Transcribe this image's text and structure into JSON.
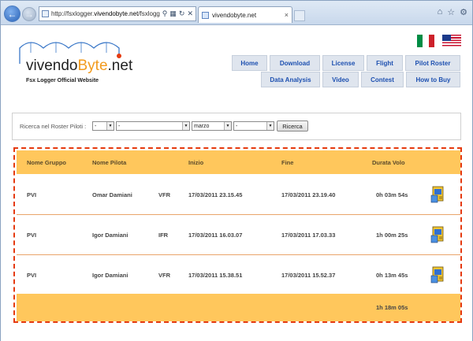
{
  "browser": {
    "address_prefix": "http://fsxlogger.",
    "address_domain": "vivendobyte.net",
    "address_suffix": "/fsxlogger/",
    "tab_title": "vivendobyte.net"
  },
  "site": {
    "logo_main": "vivendo",
    "logo_accent": "Byte",
    "logo_tail": ".net",
    "logo_subtitle": "Fsx Logger Official Website",
    "menu_row1": [
      "Home",
      "Download",
      "License",
      "Flight",
      "Pilot Roster"
    ],
    "menu_row2": [
      "Data Analysis",
      "Video",
      "Contest",
      "How to Buy"
    ],
    "colors": {
      "accent": "#f29b1d",
      "menu_text": "#1d50b0",
      "table_header": "#ffc75c",
      "frame": "#e53a10"
    }
  },
  "search": {
    "label": "Ricerca nel Roster Piloti :",
    "select1": "-",
    "select2": "-",
    "select3": "marzo",
    "select4": "-",
    "button": "Ricerca"
  },
  "table": {
    "headers": [
      "Nome Gruppo",
      "Nome Pilota",
      "",
      "Inizio",
      "Fine",
      "Durata Volo"
    ],
    "rows": [
      {
        "group": "PVI",
        "pilot": "Omar Damiani",
        "rule": "VFR",
        "start": "17/03/2011 23.15.45",
        "end": "17/03/2011 23.19.40",
        "duration": "0h 03m 54s",
        "icon": "flight-log-icon"
      },
      {
        "group": "PVI",
        "pilot": "Igor Damiani",
        "rule": "IFR",
        "start": "17/03/2011 16.03.07",
        "end": "17/03/2011 17.03.33",
        "duration": "1h 00m 25s",
        "icon": "flight-log-icon"
      },
      {
        "group": "PVI",
        "pilot": "Igor Damiani",
        "rule": "VFR",
        "start": "17/03/2011 15.38.51",
        "end": "17/03/2011 15.52.37",
        "duration": "0h 13m 45s",
        "icon": "flight-log-icon"
      }
    ],
    "total": "1h 18m 05s"
  }
}
